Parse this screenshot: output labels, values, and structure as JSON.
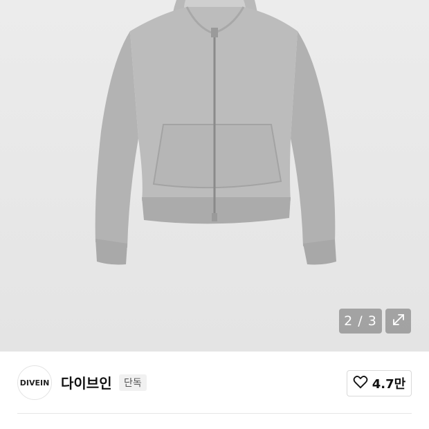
{
  "gallery": {
    "counter": "2 / 3",
    "image_icon": "gray-zip-hoodie-image",
    "expand_icon": "expand-arrows-icon"
  },
  "brand": {
    "logo_text": "DIVEIN",
    "name": "다이브인",
    "badge": "단독",
    "like_icon": "heart-icon",
    "likes": "4.7만"
  },
  "colors": {
    "image_bg": "#e8e8e8",
    "overlay": "#8c8c8c",
    "text": "#111111",
    "badge_bg": "#f1f1f1"
  }
}
